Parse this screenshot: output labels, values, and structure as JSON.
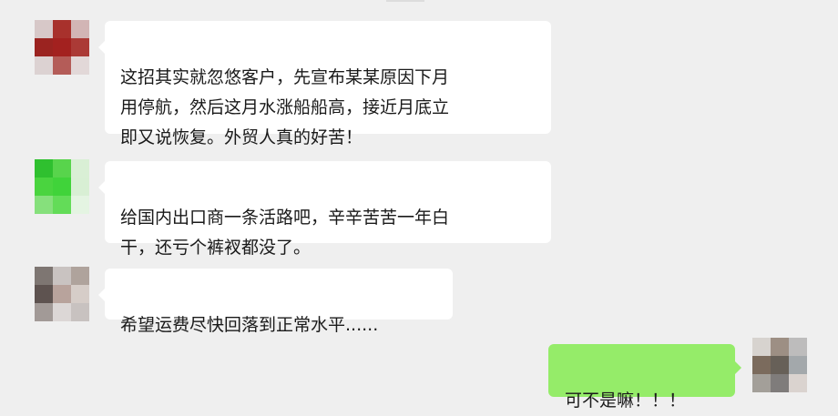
{
  "messages": [
    {
      "sender": "contact-1",
      "text": "这招其实就忽悠客户，先宣布某某原因下月\n用停航，然后这月水涨船船高，接近月底立\n即又说恢复。外贸人真的好苦！"
    },
    {
      "sender": "contact-2",
      "text": "给国内出口商一条活路吧，辛辛苦苦一年白\n干，还亏个裤衩都没了。"
    },
    {
      "sender": "contact-3",
      "text": "希望运费尽快回落到正常水平......"
    },
    {
      "sender": "self",
      "text": "可不是嘛！！！"
    }
  ],
  "colors": {
    "background": "#efefef",
    "bubble_other": "#ffffff",
    "bubble_self": "#95ec69"
  },
  "avatars": [
    {
      "owner": "contact-1",
      "icon": "pixelated-avatar",
      "pixels": [
        "#d7c8c8",
        "#a8312c",
        "#d2b5b5",
        "#9b2320",
        "#a3211f",
        "#ab3a36",
        "#dcd2d2",
        "#b45c58",
        "#e2d8d8"
      ]
    },
    {
      "owner": "contact-2",
      "icon": "pixelated-avatar",
      "pixels": [
        "#2fc02f",
        "#58d44c",
        "#d9efd5",
        "#4ad43f",
        "#40d33a",
        "#d8efd4",
        "#86e07c",
        "#63dc58",
        "#e4f4e2"
      ]
    },
    {
      "owner": "contact-3",
      "icon": "pixelated-avatar",
      "pixels": [
        "#7e7672",
        "#c9c3c1",
        "#afa39c",
        "#5e5350",
        "#b8a39c",
        "#d6cdc8",
        "#a29a97",
        "#dcd7d6",
        "#c8c2c0"
      ]
    },
    {
      "owner": "self",
      "icon": "pixelated-avatar",
      "pixels": [
        "#d7d3cf",
        "#9d8f84",
        "#bdbcbc",
        "#7b6b5d",
        "#676058",
        "#a3a8ab",
        "#a39f99",
        "#7f7c7b",
        "#dad3cf"
      ]
    }
  ]
}
